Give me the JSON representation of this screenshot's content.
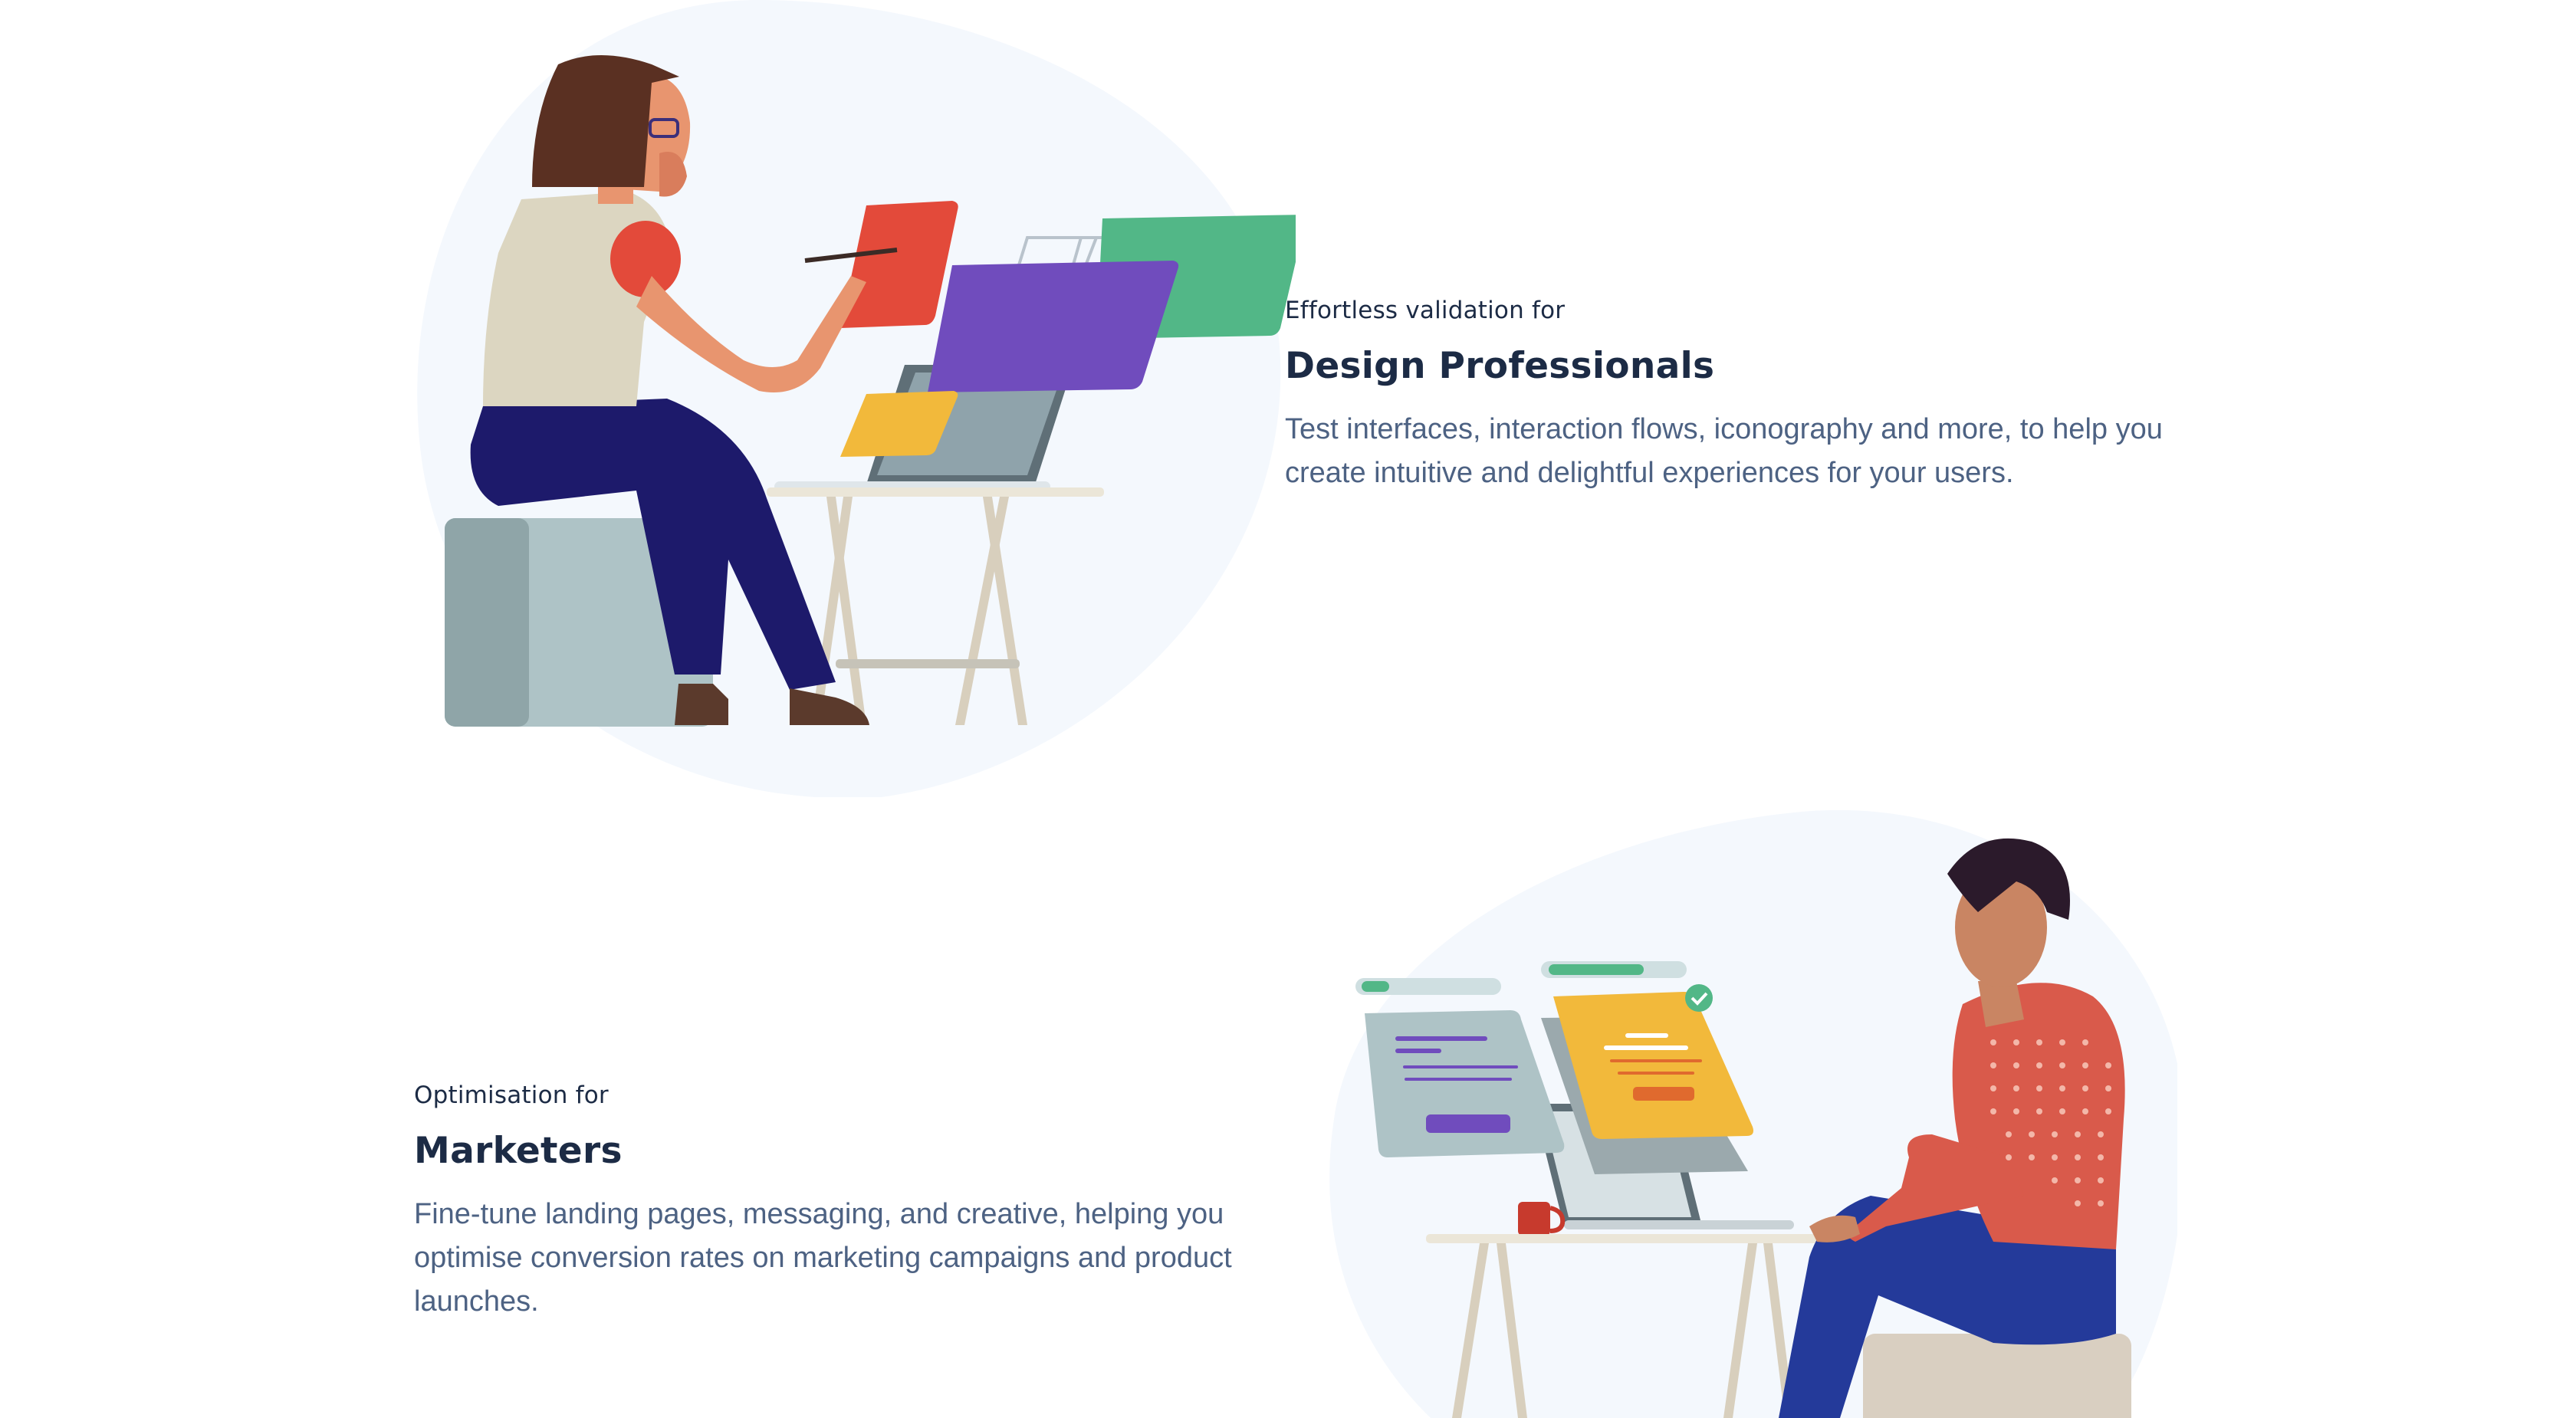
{
  "sections": [
    {
      "id": "design-professionals",
      "eyebrow": "Effortless validation for",
      "heading": "Design Professionals",
      "body": "Test interfaces, interaction flows, iconography and more, to help you create intuitive and delightful experiences for your users.",
      "illustration": "designer-at-desk-illustration"
    },
    {
      "id": "marketers",
      "eyebrow": "Optimisation for",
      "heading": "Marketers",
      "body": "Fine-tune landing pages, messaging, and creative, helping you optimise conversion rates on marketing campaigns and product launches.",
      "illustration": "marketer-at-laptop-illustration"
    }
  ],
  "colors": {
    "heading": "#1c2b45",
    "body": "#4d6283",
    "blob": "#f4f8fd",
    "red": "#e34a3a",
    "purple": "#704cbd",
    "green": "#52b787",
    "yellow": "#f2b93b",
    "navy": "#1d1a6b",
    "shirt_red": "#d95a4b"
  }
}
